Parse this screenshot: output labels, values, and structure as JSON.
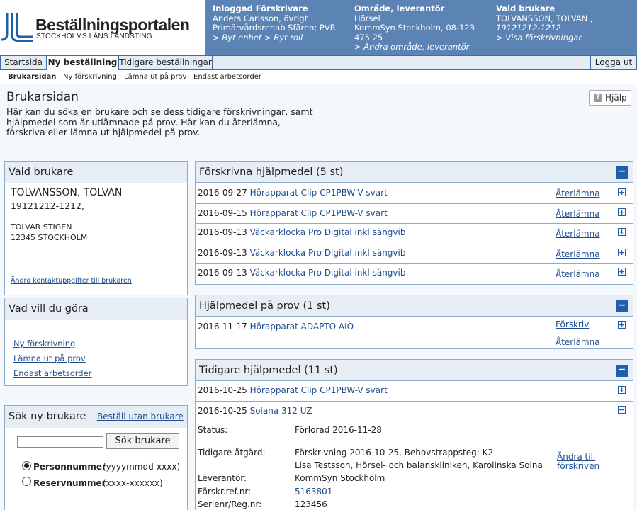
{
  "logo": {
    "title": "Beställningsportalen",
    "subtitle": "STOCKHOLMS LÄNS LANDSTING"
  },
  "header": {
    "col1": {
      "heading": "Inloggad Förskrivare",
      "line1": "Anders Carlsson, övrigt",
      "line2": "Primärvårdsrehab Sfären; PVR",
      "link": "> Byt enhet > Byt roll"
    },
    "col2": {
      "heading": "Område, leverantör",
      "line1": "Hörsel",
      "line2": "KommSyn Stockholm, 08-123",
      "line3": "475 25",
      "link": "> Ändra område, leverantör"
    },
    "col3": {
      "heading": "Vald brukare",
      "line1": "TOLVANSSON, TOLVAN ,",
      "line2": "19121212-1212",
      "link": "> Visa förskrivningar"
    }
  },
  "nav": {
    "tabs": [
      {
        "label": "Startsida"
      },
      {
        "label": "Ny beställning"
      },
      {
        "label": "Tidigare beställningar"
      }
    ],
    "logout": "Logga ut"
  },
  "subnav": [
    {
      "label": "Brukarsidan"
    },
    {
      "label": "Ny förskrivning"
    },
    {
      "label": "Lämna ut på prov"
    },
    {
      "label": "Endast arbetsorder"
    }
  ],
  "page": {
    "title": "Brukarsidan",
    "intro": "Här kan du söka en brukare och se dess tidigare förskrivningar, samt hjälpmedel som är utlämnade på prov. Här kan du återlämna, förskriva eller lämna ut hjälpmedel på prov.",
    "help": "Hjälp"
  },
  "vald": {
    "title": "Vald brukare",
    "name": "TOLVANSSON, TOLVAN",
    "pnr": "19121212-1212,",
    "street": "TOLVAR STIGEN",
    "city": "12345 STOCKHOLM",
    "edit": "Ändra kontaktuppgifter till brukaren"
  },
  "actions": {
    "title": "Vad vill du göra",
    "items": [
      {
        "label": "Ny förskrivning"
      },
      {
        "label": "Lämna ut på prov"
      },
      {
        "label": "Endast arbetsorder"
      }
    ]
  },
  "search": {
    "title": "Sök ny brukare",
    "order_link": "Beställ utan brukare",
    "value": "",
    "button": "Sök brukare",
    "opt1_label": "Personnummer",
    "opt1_hint": "(yyyymmdd-xxxx)",
    "opt2_label": "Reservnummer",
    "opt2_hint": "(xxxx-xxxxxx)"
  },
  "forskrivna": {
    "title": "Förskrivna hjälpmedel (5 st)",
    "rows": [
      {
        "date": "2016-09-27",
        "item": "Hörapparat Clip CP1PBW-V svart",
        "action": "Återlämna"
      },
      {
        "date": "2016-09-15",
        "item": "Hörapparat Clip CP1PBW-V svart",
        "action": "Återlämna"
      },
      {
        "date": "2016-09-13",
        "item": "Väckarklocka Pro Digital inkl sängvib",
        "action": "Återlämna"
      },
      {
        "date": "2016-09-13",
        "item": "Väckarklocka Pro Digital inkl sängvib",
        "action": "Återlämna"
      },
      {
        "date": "2016-09-13",
        "item": "Väckarklocka Pro Digital inkl sängvib",
        "action": "Återlämna"
      }
    ]
  },
  "prov": {
    "title": "Hjälpmedel på prov (1 st)",
    "date": "2016-11-17",
    "item": "Hörapparat ADAPTO AIÖ",
    "action1": "Förskriv",
    "action2": "Återlämna"
  },
  "tidigare": {
    "title": "Tidigare hjälpmedel (11 st)",
    "row1": {
      "date": "2016-10-25",
      "item": "Hörapparat Clip CP1PBW-V svart"
    },
    "row2": {
      "date": "2016-10-25",
      "item": "Solana 312 UZ"
    },
    "details": {
      "status_label": "Status:",
      "status_value": "Förlorad 2016-11-28",
      "atgard_label": "Tidigare åtgärd:",
      "atgard_line1": "Förskrivning 2016-10-25, Behovstrappsteg: K2",
      "atgard_line2": "Lisa Testsson, Hörsel- och balanskliniken, Karolinska Solna",
      "change_link_1": "Ändra till",
      "change_link_2": "förskriven",
      "lev_label": "Leverantör:",
      "lev_value": "KommSyn Stockholm",
      "ref_label": "Förskr.ref.nr:",
      "ref_value": "5163801",
      "serie_label": "Serienr/Reg.nr:",
      "serie_value": "123456"
    }
  }
}
